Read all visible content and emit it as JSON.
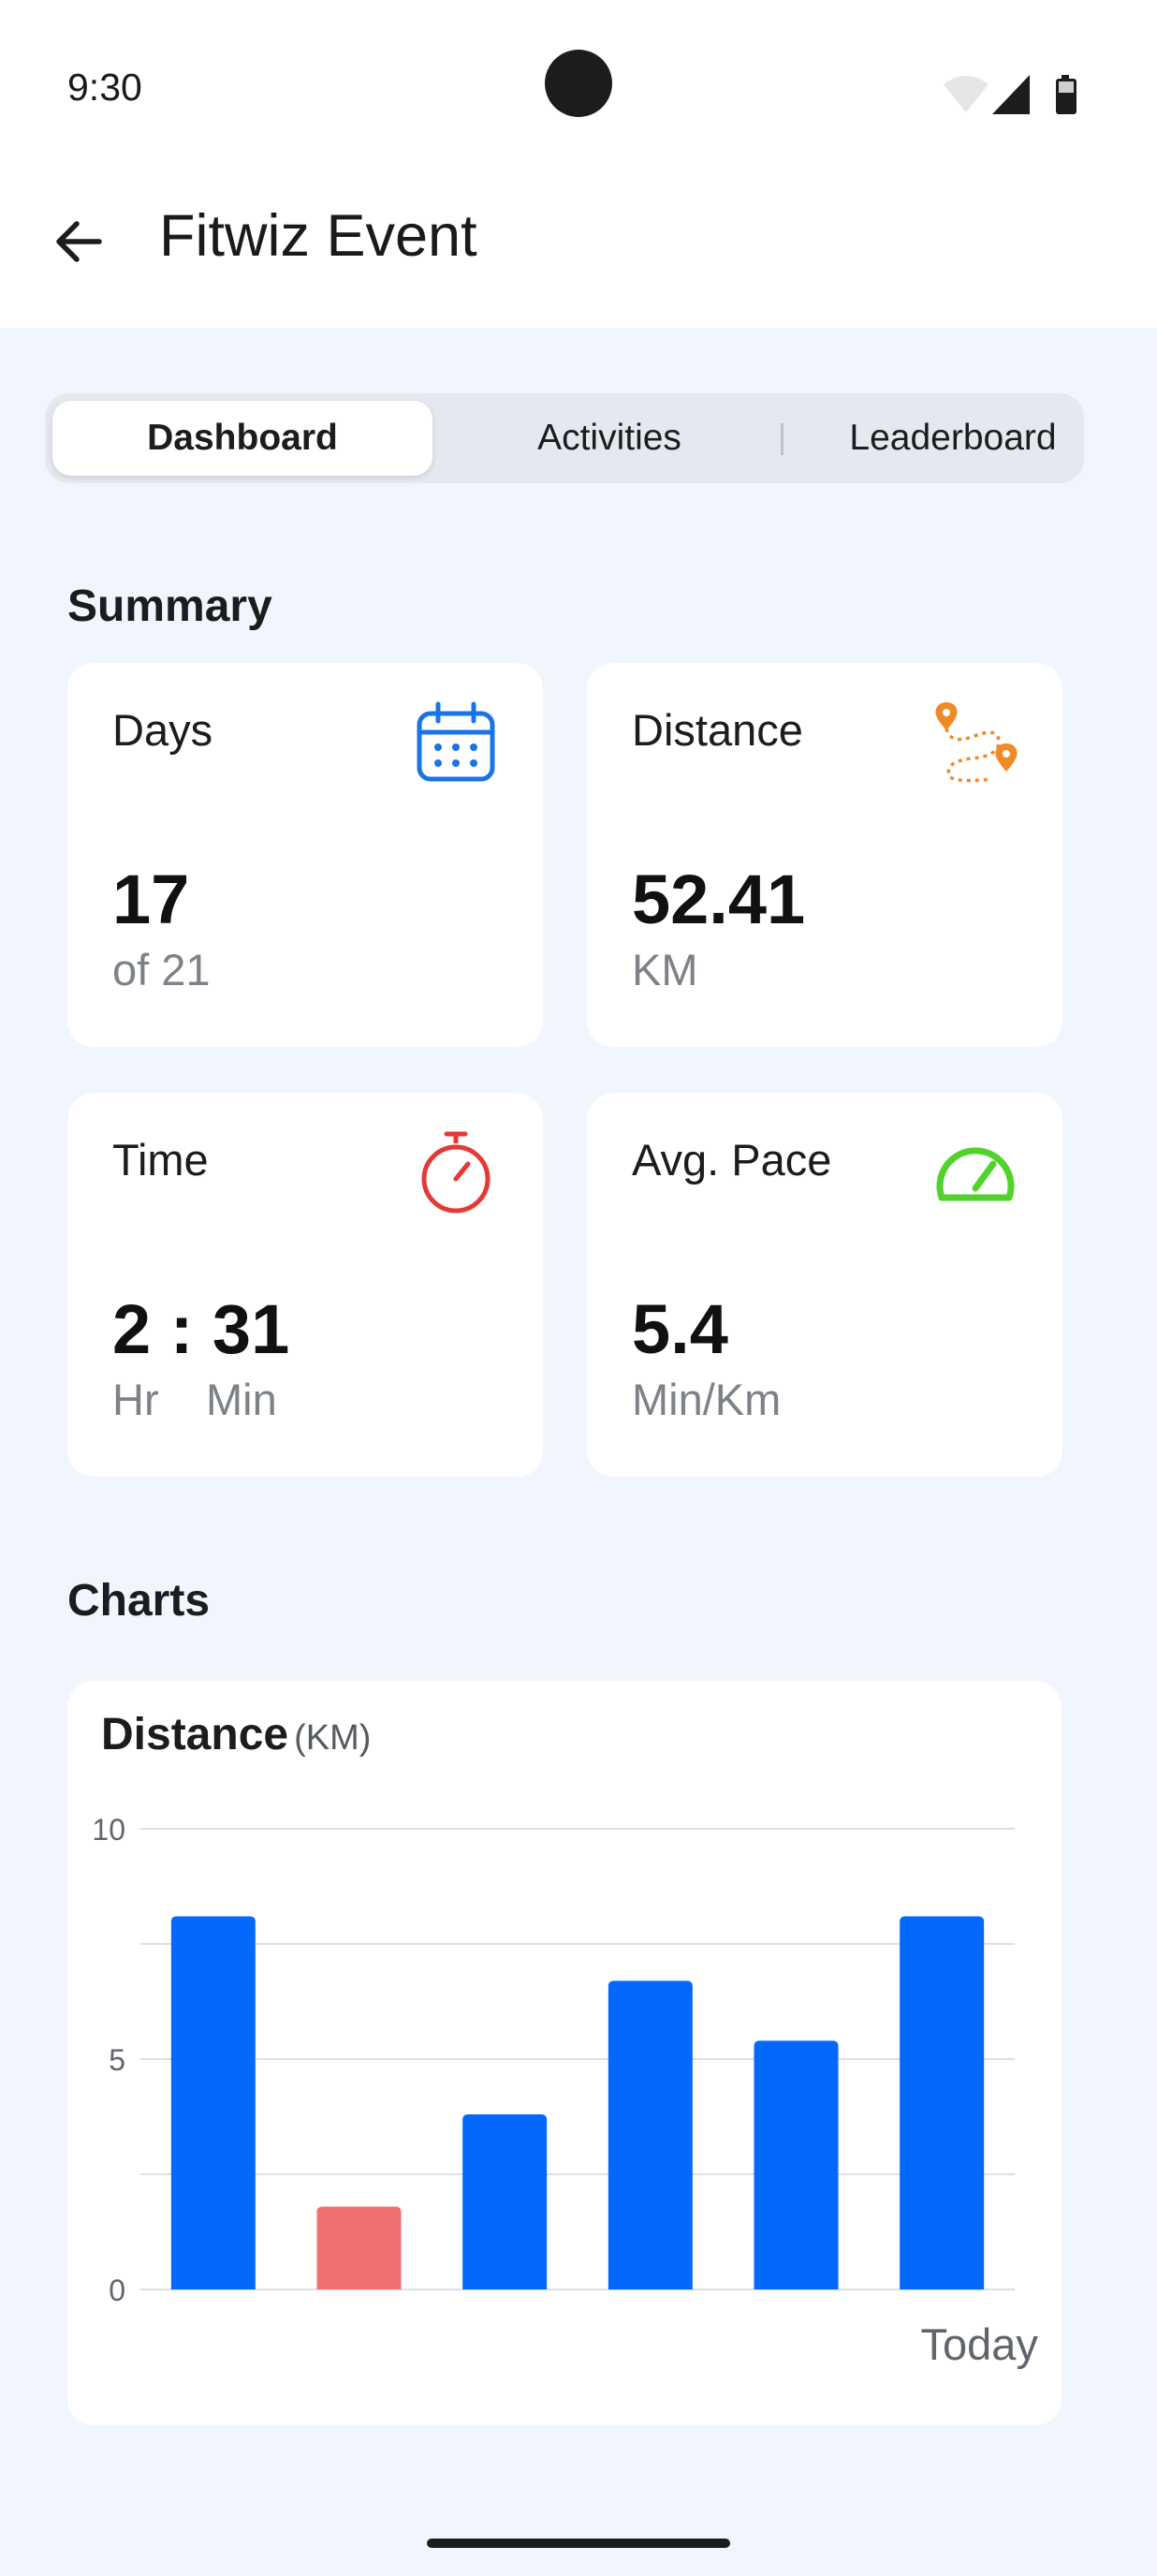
{
  "status_bar": {
    "time": "9:30"
  },
  "app_bar": {
    "title": "Fitwiz Event",
    "back_icon": "arrow-left-icon"
  },
  "tabs": [
    {
      "label": "Dashboard",
      "active": true
    },
    {
      "label": "Activities",
      "active": false
    },
    {
      "label": "Leaderboard",
      "active": false
    }
  ],
  "summary": {
    "title": "Summary",
    "days": {
      "label": "Days",
      "value": "17",
      "sub": "of 21",
      "icon": "calendar-icon",
      "color": "#1a73e8"
    },
    "distance": {
      "label": "Distance",
      "value": "52.41",
      "sub": "KM",
      "icon": "route-pin-icon",
      "color": "#f08a24"
    },
    "time": {
      "label": "Time",
      "value": "2 : 31",
      "sub_hr": "Hr",
      "sub_min": "Min",
      "icon": "stopwatch-icon",
      "color": "#e53935"
    },
    "pace": {
      "label": "Avg. Pace",
      "value": "5.4",
      "sub": "Min/Km",
      "icon": "speedometer-icon",
      "color": "#52d32c"
    }
  },
  "charts": {
    "title": "Charts"
  },
  "chart_data": {
    "type": "bar",
    "title": "Distance",
    "unit": "(KM)",
    "categories": [
      "",
      "",
      "",
      "",
      "",
      "Today"
    ],
    "values": [
      8.1,
      1.8,
      3.8,
      6.7,
      5.4,
      8.1
    ],
    "ylim": [
      0,
      10
    ],
    "yticks": [
      0,
      5,
      10
    ],
    "grid": true,
    "colors": {
      "default": "#0568fd",
      "highlight": "#f07070"
    },
    "highlight_index": 1,
    "xlabel": "",
    "ylabel": ""
  }
}
